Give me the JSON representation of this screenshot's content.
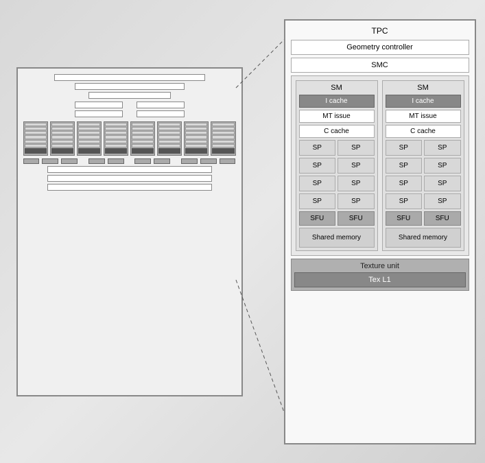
{
  "tpc": {
    "title": "TPC",
    "geometry_controller": "Geometry controller",
    "smc_label": "SMC",
    "sm1": {
      "label": "SM",
      "i_cache": "I cache",
      "mt_issue": "MT issue",
      "c_cache": "C cache",
      "sp_rows": [
        [
          "SP",
          "SP"
        ],
        [
          "SP",
          "SP"
        ],
        [
          "SP",
          "SP"
        ],
        [
          "SP",
          "SP"
        ]
      ],
      "sfu_row": [
        "SFU",
        "SFU"
      ],
      "shared_memory": "Shared memory"
    },
    "sm2": {
      "label": "SM",
      "i_cache": "I cache",
      "mt_issue": "MT issue",
      "c_cache": "C cache",
      "sp_rows": [
        [
          "SP",
          "SP"
        ],
        [
          "SP",
          "SP"
        ],
        [
          "SP",
          "SP"
        ],
        [
          "SP",
          "SP"
        ]
      ],
      "sfu_row": [
        "SFU",
        "SFU"
      ],
      "shared_memory": "Shared memory"
    },
    "texture_unit": "Texture unit",
    "tex_l1": "Tex L1"
  }
}
